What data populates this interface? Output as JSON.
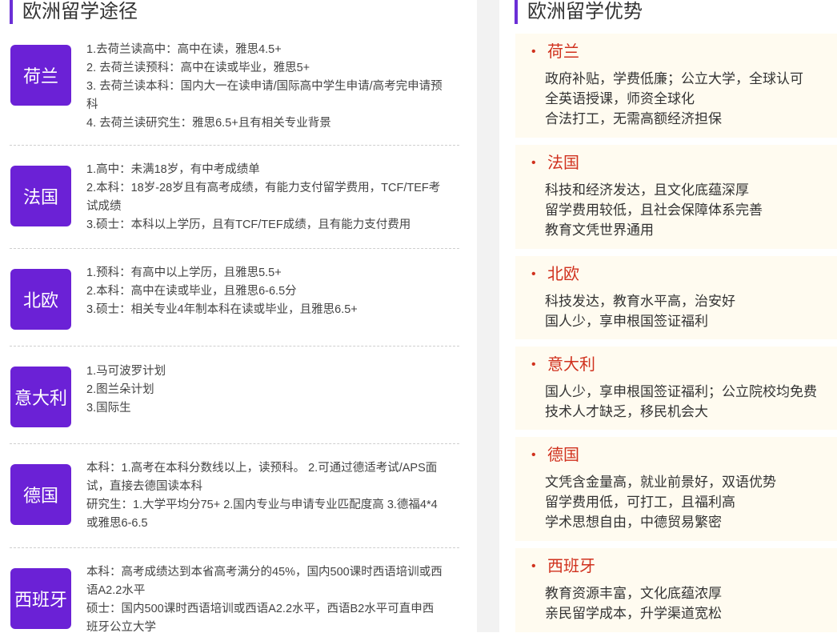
{
  "left": {
    "title": "欧洲留学途径",
    "routes": [
      {
        "country": "荷兰",
        "lines": [
          "1.去荷兰读高中：高中在读，雅思4.5+",
          "2. 去荷兰读预科：高中在读或毕业，雅思5+",
          "3. 去荷兰读本科：国内大一在读申请/国际高中学生申请/高考完申请预科",
          "4. 去荷兰读研究生：雅思6.5+且有相关专业背景"
        ]
      },
      {
        "country": "法国",
        "lines": [
          "1.高中：未满18岁，有中考成绩单",
          "2.本科：18岁-28岁且有高考成绩，有能力支付留学费用，TCF/TEF考试成绩",
          "3.硕士：本科以上学历，且有TCF/TEF成绩，且有能力支付费用"
        ]
      },
      {
        "country": "北欧",
        "lines": [
          "1.预科：有高中以上学历，且雅思5.5+",
          "2.本科：高中在读或毕业，且雅思6-6.5分",
          "3.硕士：相关专业4年制本科在读或毕业，且雅思6.5+"
        ]
      },
      {
        "country": "意大利",
        "lines": [
          "1.马可波罗计划",
          "2.图兰朵计划",
          "3.国际生"
        ]
      },
      {
        "country": "德国",
        "lines": [
          "本科：1.高考在本科分数线以上，读预科。 2.可通过德适考试/APS面试，直接去德国读本科",
          "研究生：1.大学平均分75+ 2.国内专业与申请专业匹配度高 3.德福4*4或雅思6-6.5"
        ]
      },
      {
        "country": "西班牙",
        "lines": [
          "本科：高考成绩达到本省高考满分的45%，国内500课时西语培训或西语A2.2水平",
          "硕士：国内500课时西语培训或西语A2.2水平，西语B2水平可直申西班牙公立大学"
        ]
      }
    ]
  },
  "right": {
    "title": "欧洲留学优势",
    "bullet": "•",
    "advantages": [
      {
        "country": "荷兰",
        "lines": [
          "政府补贴，学费低廉；公立大学，全球认可",
          "全英语授课，师资全球化",
          "合法打工，无需高额经济担保"
        ]
      },
      {
        "country": "法国",
        "lines": [
          "科技和经济发达，且文化底蕴深厚",
          "留学费用较低，且社会保障体系完善",
          "教育文凭世界通用"
        ]
      },
      {
        "country": "北欧",
        "lines": [
          "科技发达，教育水平高，治安好",
          "国人少，享申根国签证福利"
        ]
      },
      {
        "country": "意大利",
        "lines": [
          "国人少，享申根国签证福利；公立院校均免费",
          "技术人才缺乏，移民机会大"
        ]
      },
      {
        "country": "德国",
        "lines": [
          "文凭含金量高，就业前景好，双语优势",
          "留学费用低，可打工，且福利高",
          "学术思想自由，中德贸易繁密"
        ]
      },
      {
        "country": "西班牙",
        "lines": [
          "教育资源丰富，文化底蕴浓厚",
          "亲民留学成本，升学渠道宽松"
        ]
      }
    ]
  },
  "colors": {
    "accent_purple": "#6b21d6",
    "title_red": "#d0311e",
    "card_bg": "#fffbf0",
    "gap_gray": "#f2f2f2"
  }
}
